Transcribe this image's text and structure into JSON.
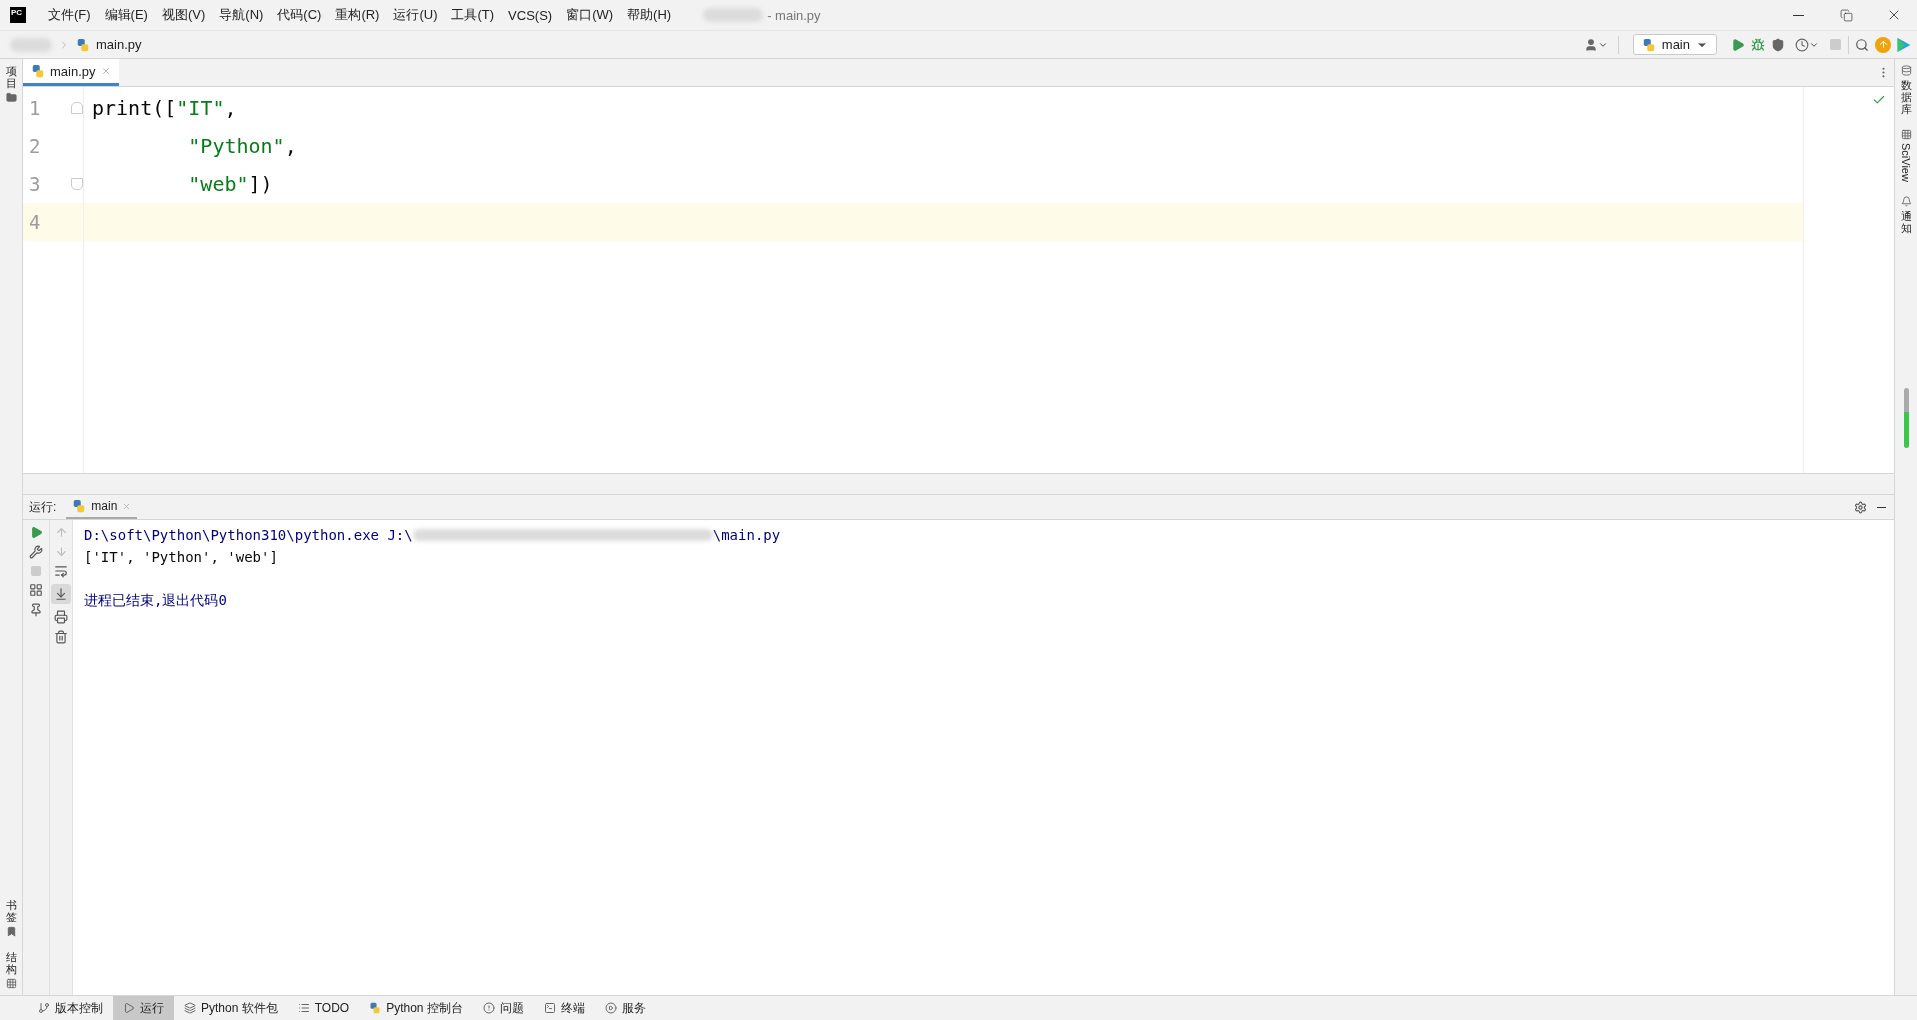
{
  "title_bar": {
    "logo": "PC",
    "menu": [
      "文件(F)",
      "编辑(E)",
      "视图(V)",
      "导航(N)",
      "代码(C)",
      "重构(R)",
      "运行(U)",
      "工具(T)",
      "VCS(S)",
      "窗口(W)",
      "帮助(H)"
    ],
    "title": "- main.py"
  },
  "navigation_bar": {
    "breadcrumb": "main.py",
    "run_config": "main"
  },
  "left_strip": {
    "top": [
      "项目"
    ],
    "bottom": [
      "书签",
      "结构"
    ]
  },
  "right_strip": [
    "数据库",
    "SciView",
    "通知"
  ],
  "editor": {
    "tabs": [
      {
        "label": "main.py",
        "selected": true
      }
    ],
    "lines": [
      {
        "number": "1",
        "current": false,
        "kind": "opener",
        "tokens": [
          {
            "kind": "plain",
            "text": "print(["
          },
          {
            "kind": "string",
            "text": "\"IT\""
          },
          {
            "kind": "plain",
            "text": ","
          }
        ]
      },
      {
        "number": "2",
        "current": false,
        "kind": "plain",
        "tokens": [
          {
            "kind": "string",
            "text": "        \"Python\""
          },
          {
            "kind": "plain",
            "text": ","
          }
        ]
      },
      {
        "number": "3",
        "current": false,
        "kind": "closer",
        "tokens": [
          {
            "kind": "string",
            "text": "        \"web\""
          },
          {
            "kind": "plain",
            "text": "])"
          }
        ]
      },
      {
        "number": "4",
        "current": true,
        "kind": "plain"
      }
    ]
  },
  "run_panel": {
    "label": "运行:",
    "tabs": [
      {
        "label": "main",
        "selected": true
      }
    ],
    "output": [
      {
        "kind": "command",
        "text": "D:\\soft\\Python\\Python310\\python.exe J:\\",
        "suffix": "\\main.py"
      },
      {
        "kind": "plain",
        "text": "['IT', 'Python', 'web']"
      },
      {
        "kind": "blank"
      },
      {
        "kind": "status",
        "text": "进程已结束,退出代码0"
      }
    ]
  },
  "status_bar": [
    {
      "label": "版本控制",
      "kind": "vcs",
      "selected": false
    },
    {
      "label": "运行",
      "kind": "run",
      "selected": true
    },
    {
      "label": "Python 软件包",
      "kind": "packages",
      "selected": false
    },
    {
      "label": "TODO",
      "kind": "todo",
      "selected": false
    },
    {
      "label": "Python 控制台",
      "kind": "console",
      "selected": false
    },
    {
      "label": "问题",
      "kind": "problems",
      "selected": false
    },
    {
      "label": "终端",
      "kind": "terminal",
      "selected": false
    },
    {
      "label": "服务",
      "kind": "services",
      "selected": false
    }
  ]
}
